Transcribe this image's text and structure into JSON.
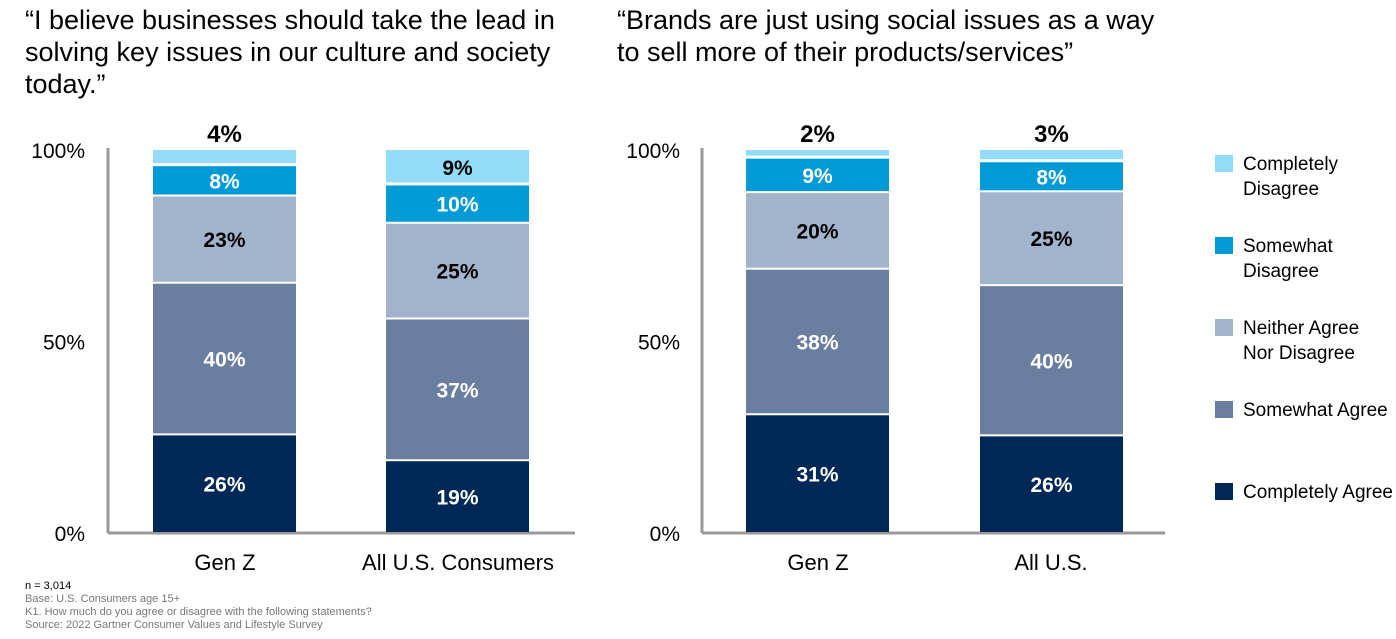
{
  "chart_data": [
    {
      "type": "bar",
      "stacked": true,
      "title": "“I believe businesses should take the lead in solving key issues in our culture and society today.”",
      "categories": [
        "Gen Z",
        "All U.S. Consumers"
      ],
      "yticks": [
        "0%",
        "50%",
        "100%"
      ],
      "ylim": [
        0,
        100
      ],
      "series": [
        {
          "name": "Completely Agree",
          "values": [
            26,
            19
          ]
        },
        {
          "name": "Somewhat Agree",
          "values": [
            40,
            37
          ]
        },
        {
          "name": "Neither Agree Nor Disagree",
          "values": [
            23,
            25
          ]
        },
        {
          "name": "Somewhat Disagree",
          "values": [
            8,
            10
          ]
        },
        {
          "name": "Completely Disagree",
          "values": [
            4,
            9
          ]
        }
      ]
    },
    {
      "type": "bar",
      "stacked": true,
      "title": "“Brands are just using social issues as a way to sell more of their products/services”",
      "categories": [
        "Gen Z",
        "All U.S."
      ],
      "yticks": [
        "0%",
        "50%",
        "100%"
      ],
      "ylim": [
        0,
        100
      ],
      "series": [
        {
          "name": "Completely Agree",
          "values": [
            31,
            26
          ]
        },
        {
          "name": "Somewhat Agree",
          "values": [
            38,
            40
          ]
        },
        {
          "name": "Neither Agree Nor Disagree",
          "values": [
            20,
            25
          ]
        },
        {
          "name": "Somewhat Disagree",
          "values": [
            9,
            8
          ]
        },
        {
          "name": "Completely Disagree",
          "values": [
            2,
            3
          ]
        }
      ]
    }
  ],
  "colors": [
    "#002856",
    "#6a7fa0",
    "#a2b3cc",
    "#009ad6",
    "#92dcf8"
  ],
  "legend": {
    "placement": "right",
    "items": [
      {
        "label": "Completely Disagree",
        "color": "#92dcf8"
      },
      {
        "label": "Somewhat Disagree",
        "color": "#009ad6"
      },
      {
        "label": "Neither Agree Nor Disagree",
        "color": "#a2b3cc"
      },
      {
        "label": "Somewhat Agree",
        "color": "#6a7fa0"
      },
      {
        "label": "Completely Agree",
        "color": "#002856"
      }
    ]
  },
  "footnotes": {
    "n": "n = 3,014",
    "base": "Base: U.S. Consumers age 15+",
    "question": "K1. How much do you agree or disagree with the following statements?",
    "source": "Source: 2022 Gartner Consumer Values and Lifestyle Survey"
  }
}
